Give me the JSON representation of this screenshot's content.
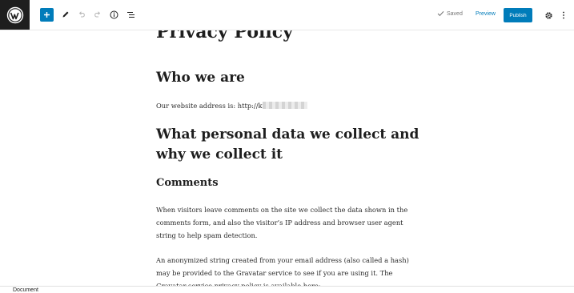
{
  "toolbar": {
    "saved_label": "Saved",
    "preview_label": "Preview",
    "publish_label": "Publish",
    "icons": [
      "wordpress-logo-icon",
      "plus-icon",
      "pencil-icon",
      "undo-icon",
      "redo-icon",
      "info-icon",
      "list-view-icon",
      "check-icon",
      "gear-icon",
      "more-vertical-icon"
    ],
    "accent_color": "#007cba"
  },
  "document": {
    "title": "Privacy Policy",
    "heading_who": "Who we are",
    "address_text": "Our website address is: http://k",
    "heading_data": "What personal data we collect and why we collect it",
    "heading_comments": "Comments",
    "para_comments": "When visitors leave comments on the site we collect the data shown in the comments form, and also the visitor’s IP address and browser user agent string to help spam detection.",
    "para_anonymized": "An anonymized string created from your email address (also called a hash) may be provided to the Gravatar service to see if you are using it. The Gravatar service privacy policy is available here:"
  },
  "footer": {
    "breadcrumb": "Document"
  }
}
